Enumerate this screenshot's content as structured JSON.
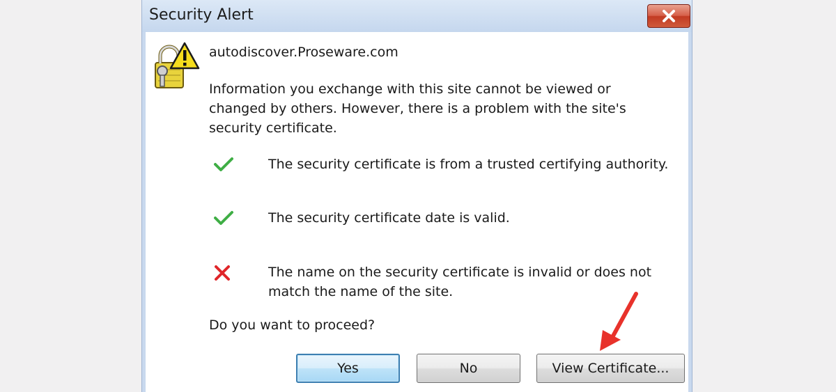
{
  "dialog": {
    "title": "Security Alert",
    "close_icon": "close-icon",
    "host": "autodiscover.Proseware.com",
    "message": "Information you exchange with this site cannot be viewed or changed by others. However, there is a problem with the site's security certificate.",
    "checks": [
      {
        "status": "ok",
        "icon": "checkmark-icon",
        "text": "The security certificate is from a trusted certifying authority."
      },
      {
        "status": "ok",
        "icon": "checkmark-icon",
        "text": "The security certificate date is valid."
      },
      {
        "status": "error",
        "icon": "x-icon",
        "text": "The name on the security certificate is invalid or does not match the name of the site."
      }
    ],
    "question": "Do you want to proceed?",
    "buttons": {
      "yes": "Yes",
      "no": "No",
      "view_certificate": "View Certificate..."
    }
  },
  "annotation": {
    "arrow_color": "#e8322b"
  },
  "colors": {
    "ok": "#3fae45",
    "error": "#e0262a",
    "close_button": "#c9452b"
  }
}
